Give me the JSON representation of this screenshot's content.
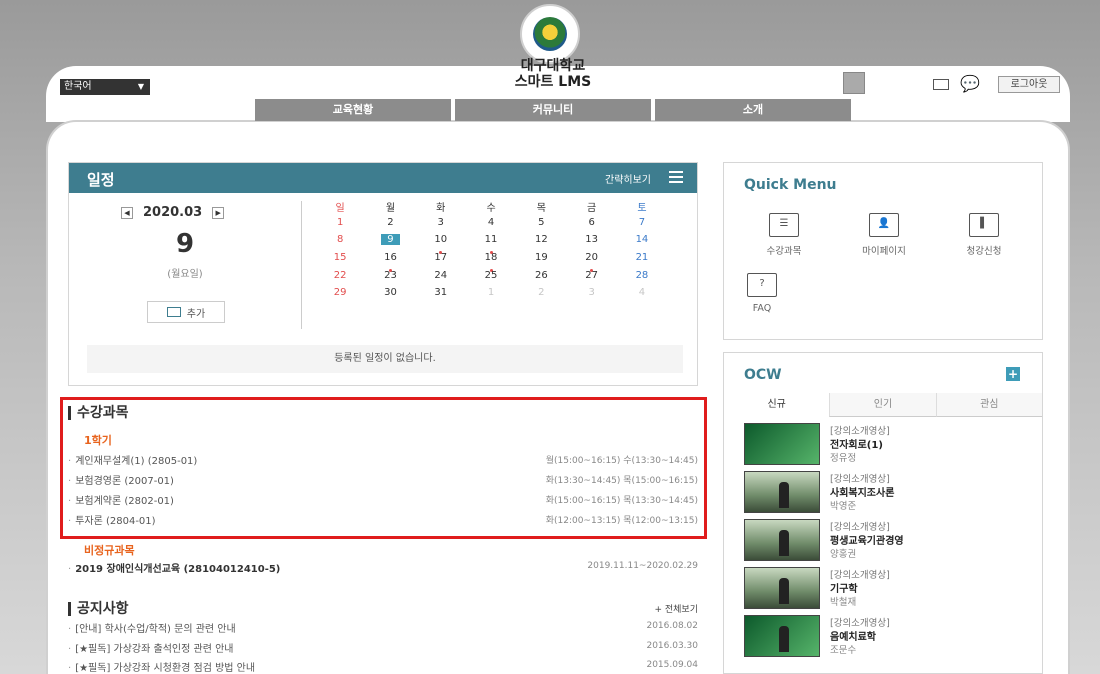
{
  "header": {
    "site_title_line1": "대구대학교",
    "site_title_line2": "스마트 LMS",
    "language": "한국어",
    "logout_label": "로그아웃"
  },
  "nav": [
    "교육현황",
    "커뮤니티",
    "소개"
  ],
  "schedule": {
    "title": "일정",
    "simple_view": "간략히보기",
    "month": "2020.03",
    "day": "9",
    "weekday": "(월요일)",
    "add_label": "추가",
    "no_schedule": "등록된 일정이 없습니다.",
    "weekday_headers": [
      "일",
      "월",
      "화",
      "수",
      "목",
      "금",
      "토"
    ],
    "weeks": [
      [
        "1",
        "2",
        "3",
        "4",
        "5",
        "6",
        "7"
      ],
      [
        "8",
        "9",
        "10",
        "11",
        "12",
        "13",
        "14"
      ],
      [
        "15",
        "16",
        "17",
        "18",
        "19",
        "20",
        "21"
      ],
      [
        "22",
        "23",
        "24",
        "25",
        "26",
        "27",
        "28"
      ],
      [
        "29",
        "30",
        "31",
        "1",
        "2",
        "3",
        "4"
      ]
    ]
  },
  "courses": {
    "title": "수강과목",
    "term": "1학기",
    "items": [
      {
        "name": "계인재무설계(1) (2805-01)",
        "time": "월(15:00~16:15) 수(13:30~14:45)"
      },
      {
        "name": "보험경영론 (2007-01)",
        "time": "화(13:30~14:45) 목(15:00~16:15)"
      },
      {
        "name": "보험계약론 (2802-01)",
        "time": "화(15:00~16:15) 목(13:30~14:45)"
      },
      {
        "name": "투자론 (2804-01)",
        "time": "화(12:00~13:15) 목(12:00~13:15)"
      }
    ],
    "nonregular_label": "비정규과목",
    "nonregular_item": {
      "name": "2019 장애인식개선교육 (28104012410-5)",
      "time": "2019.11.11~2020.02.29"
    }
  },
  "notices": {
    "title": "공지사항",
    "view_all": "+ 전체보기",
    "items": [
      {
        "text": "[안내] 학사(수업/학적) 문의 관련 안내",
        "date": "2016.08.02"
      },
      {
        "text": "[★필독] 가상강좌 출석인정 관련 안내",
        "date": "2016.03.30"
      },
      {
        "text": "[★필독] 가상강좌 시청환경 점검 방법 안내",
        "date": "2015.09.04"
      }
    ]
  },
  "quick_menu": {
    "title": "Quick Menu",
    "items": [
      {
        "label": "수강과목",
        "icon": "course-icon"
      },
      {
        "label": "마이페이지",
        "icon": "mypage-icon"
      },
      {
        "label": "청강신청",
        "icon": "audit-icon"
      },
      {
        "label": "FAQ",
        "icon": "faq-icon"
      }
    ]
  },
  "ocw": {
    "title": "OCW",
    "tabs": [
      "신규",
      "인기",
      "관심"
    ],
    "items": [
      {
        "category": "[강의소개영상]",
        "name": "전자회로(1)",
        "author": "정유정"
      },
      {
        "category": "[강의소개영상]",
        "name": "사회복지조사론",
        "author": "박영준"
      },
      {
        "category": "[강의소개영상]",
        "name": "평생교육기관경영",
        "author": "양홍권"
      },
      {
        "category": "[강의소개영상]",
        "name": "기구학",
        "author": "박철재"
      },
      {
        "category": "[강의소개영상]",
        "name": "음예치료학",
        "author": "조문수"
      }
    ]
  },
  "colors": {
    "accent": "#3e7d8f",
    "highlight_box": "#e01c1c",
    "term": "#e8641e"
  }
}
